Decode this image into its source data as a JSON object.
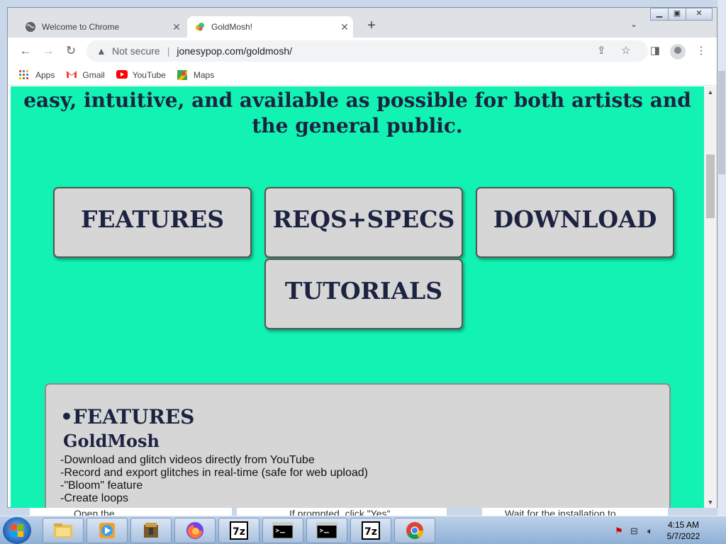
{
  "browser": {
    "tabs": [
      {
        "title": "Welcome to Chrome",
        "active": false
      },
      {
        "title": "GoldMosh!",
        "active": true
      }
    ],
    "new_tab": "+",
    "address": {
      "security": "Not secure",
      "url": "jonesypop.com/goldmosh/"
    },
    "bookmarks": [
      {
        "label": "Apps",
        "icon": "apps-grid-icon"
      },
      {
        "label": "Gmail",
        "icon": "gmail-icon"
      },
      {
        "label": "YouTube",
        "icon": "youtube-icon"
      },
      {
        "label": "Maps",
        "icon": "maps-icon"
      }
    ]
  },
  "page": {
    "intro_line1": "easy, intuitive, and available as possible for both artists and",
    "intro_line2": "the general public.",
    "nav_buttons": [
      "FEATURES",
      "REQS+SPECS",
      "DOWNLOAD",
      "TUTORIALS"
    ],
    "features": {
      "heading": "•FEATURES",
      "subheading": "GoldMosh",
      "items": [
        "-Download and glitch videos directly from YouTube",
        "-Record and export glitches in real-time (safe for web upload)",
        "-\"Bloom\" feature",
        "-Create loops"
      ]
    }
  },
  "behind_window": {
    "snippets": [
      "Open the",
      "If prompted, click \"Yes\"",
      "Wait for the installation to"
    ]
  },
  "taskbar": {
    "time": "4:15 AM",
    "date": "5/7/2022",
    "apps": [
      "explorer-icon",
      "media-player-icon",
      "archive-manager-icon",
      "firefox-icon",
      "7zip-icon",
      "cmd-icon",
      "cmd-icon",
      "7zip-icon",
      "chrome-icon"
    ]
  },
  "colors": {
    "page_bg": "#12f3b3",
    "text_dark": "#1c2340",
    "card_bg": "#d6d6d6"
  }
}
